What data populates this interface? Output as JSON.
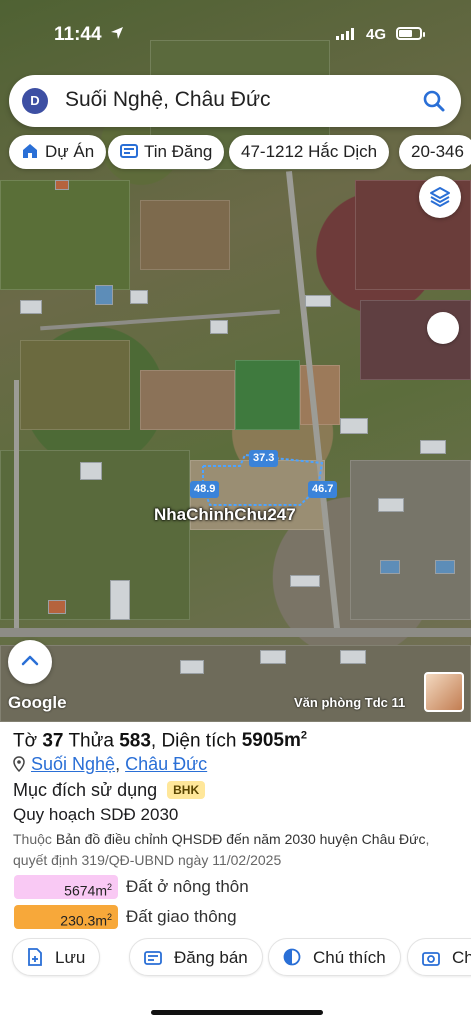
{
  "status_bar": {
    "time": "11:44",
    "network": "4G"
  },
  "search": {
    "avatar_letter": "D",
    "query": "Suối Nghệ, Châu Đức"
  },
  "chips": [
    {
      "label": "Dự Án",
      "icon": "home-icon"
    },
    {
      "label": "Tin Đăng",
      "icon": "listing-icon"
    },
    {
      "label": "47-1212 Hắc Dịch"
    },
    {
      "label": "20-346"
    }
  ],
  "map": {
    "measurements": [
      "37.3",
      "48.9",
      "46.7"
    ],
    "watermark": "NhaChinhChu247",
    "google": "Google",
    "office_label": "Văn phòng Tdc 11"
  },
  "parcel": {
    "title_prefix": "Tờ",
    "sheet": "37",
    "plot_label": "Thửa",
    "plot": "583",
    "area_label": "Diện tích",
    "area": "5905m",
    "area_sup": "2",
    "ward": "Suối Nghệ",
    "district": "Châu Đức",
    "separator": ",",
    "purpose_label": "Mục đích sử dụng",
    "purpose_code": "BHK",
    "plan_title": "Quy hoạch SDĐ 2030",
    "plan_desc_prefix": "Thuộc",
    "plan_desc": "Bản đồ điều chỉnh QHSDĐ đến năm 2030 huyện Châu Đức",
    "plan_decision": ", quyết định 319/QĐ-UBND ngày 11/02/2025",
    "legend": [
      {
        "value": "5674m",
        "sup": "2",
        "label": "Đất ở nông thôn",
        "color": "#f9c9f4"
      },
      {
        "value": "230.3m",
        "sup": "2",
        "label": "Đất giao thông",
        "color": "#f7a83a"
      }
    ]
  },
  "actions": [
    {
      "label": "Lưu",
      "icon": "save-icon"
    },
    {
      "label": "Đăng bán",
      "icon": "post-sale-icon"
    },
    {
      "label": "Chú thích",
      "icon": "legend-icon"
    },
    {
      "label": "Ch",
      "icon": "camera-icon"
    }
  ],
  "colors": {
    "accent": "#2a6fd6",
    "parcel_line": "#3a83d9",
    "badge": "#ffe79a"
  }
}
